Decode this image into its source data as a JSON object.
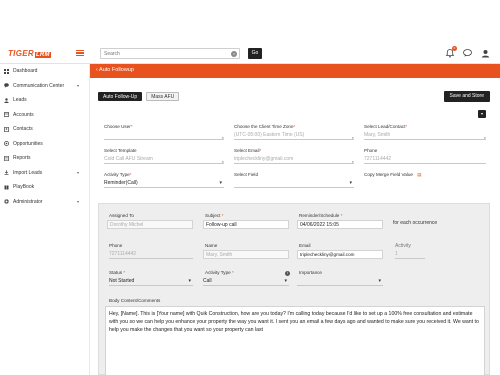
{
  "app": {
    "logo_main": "TIGER",
    "logo_sub": "LRM"
  },
  "topbar": {
    "search_placeholder": "Search",
    "go_label": "Go",
    "notification_count": "0"
  },
  "sidebar": {
    "items": [
      {
        "label": "Dashboard",
        "icon": "dashboard-icon",
        "chevron": ""
      },
      {
        "label": "Communication Center",
        "icon": "chat-icon",
        "chevron": "▾"
      },
      {
        "label": "Leads",
        "icon": "leads-icon",
        "chevron": ""
      },
      {
        "label": "Accounts",
        "icon": "accounts-icon",
        "chevron": ""
      },
      {
        "label": "Contacts",
        "icon": "contacts-icon",
        "chevron": ""
      },
      {
        "label": "Opportunities",
        "icon": "opportunities-icon",
        "chevron": ""
      },
      {
        "label": "Reports",
        "icon": "reports-icon",
        "chevron": ""
      },
      {
        "label": "Import Leads",
        "icon": "import-icon",
        "chevron": "▾"
      },
      {
        "label": "PlayBook",
        "icon": "playbook-icon",
        "chevron": ""
      },
      {
        "label": "Administrator",
        "icon": "admin-icon",
        "chevron": "▾"
      }
    ]
  },
  "page": {
    "back_title": "‹ Auto Followup",
    "tabs": [
      "Auto Follow-Up",
      "Mass AFU"
    ],
    "save_label": "Save and Store"
  },
  "form": {
    "choose_user_label": "Choose User",
    "time_zone_label": "Choose the Client Time Zone",
    "time_zone_value": "(UTC-05:00) Eastern Time (US)",
    "lead_contact_label": "Select Lead/Contact",
    "lead_contact_value": "Mary, Smith",
    "template_label": "Select Template",
    "template_value": "Cold Call AFU Stream",
    "email_label": "Select Email",
    "email_value": "triplecheckliny@gmail.com",
    "phone_label": "Phone",
    "phone_value": "7271114442",
    "activity_type_label": "Activity Type",
    "activity_type_value": "Reminder(Call)",
    "field_label": "Select Field",
    "copy_merge_label": "Copy Merge Field Value"
  },
  "panel": {
    "assigned_to_label": "Assigned To",
    "assigned_to_value": "Dorothy Michel",
    "subject_label": "Subject",
    "subject_value": "Follow-up call",
    "reminder_label": "Reminder/Schedule",
    "reminder_value": "04/06/2022 15:05",
    "occurrence_text": "for each occurrence",
    "phone_label": "Phone",
    "phone_value": "7271114442",
    "name_label": "Name",
    "name_value": "Mary, Smith",
    "email_label": "Email",
    "email_value": "triplecheckliny@gmail.com",
    "activity_label": "Activity",
    "activity_value": "1",
    "status_label": "Status",
    "status_value": "Not Started",
    "activity_type_label": "Activity Type",
    "activity_type_value": "Call",
    "importance_label": "Importance",
    "body_label": "Body Content/Comments",
    "body_text": "Hey, [Name]. This is [Your name] with Quik Construction, how are you today? I'm calling today because I'd like to set up a 100% free consultation and estimate with you so we can help you enhance your property the way you want it. I sent you an email a few days ago and wanted to make sure you received it. We want to help you make the changes that you want so your property can last"
  },
  "colors": {
    "accent": "#e8521f",
    "dark": "#222222"
  }
}
